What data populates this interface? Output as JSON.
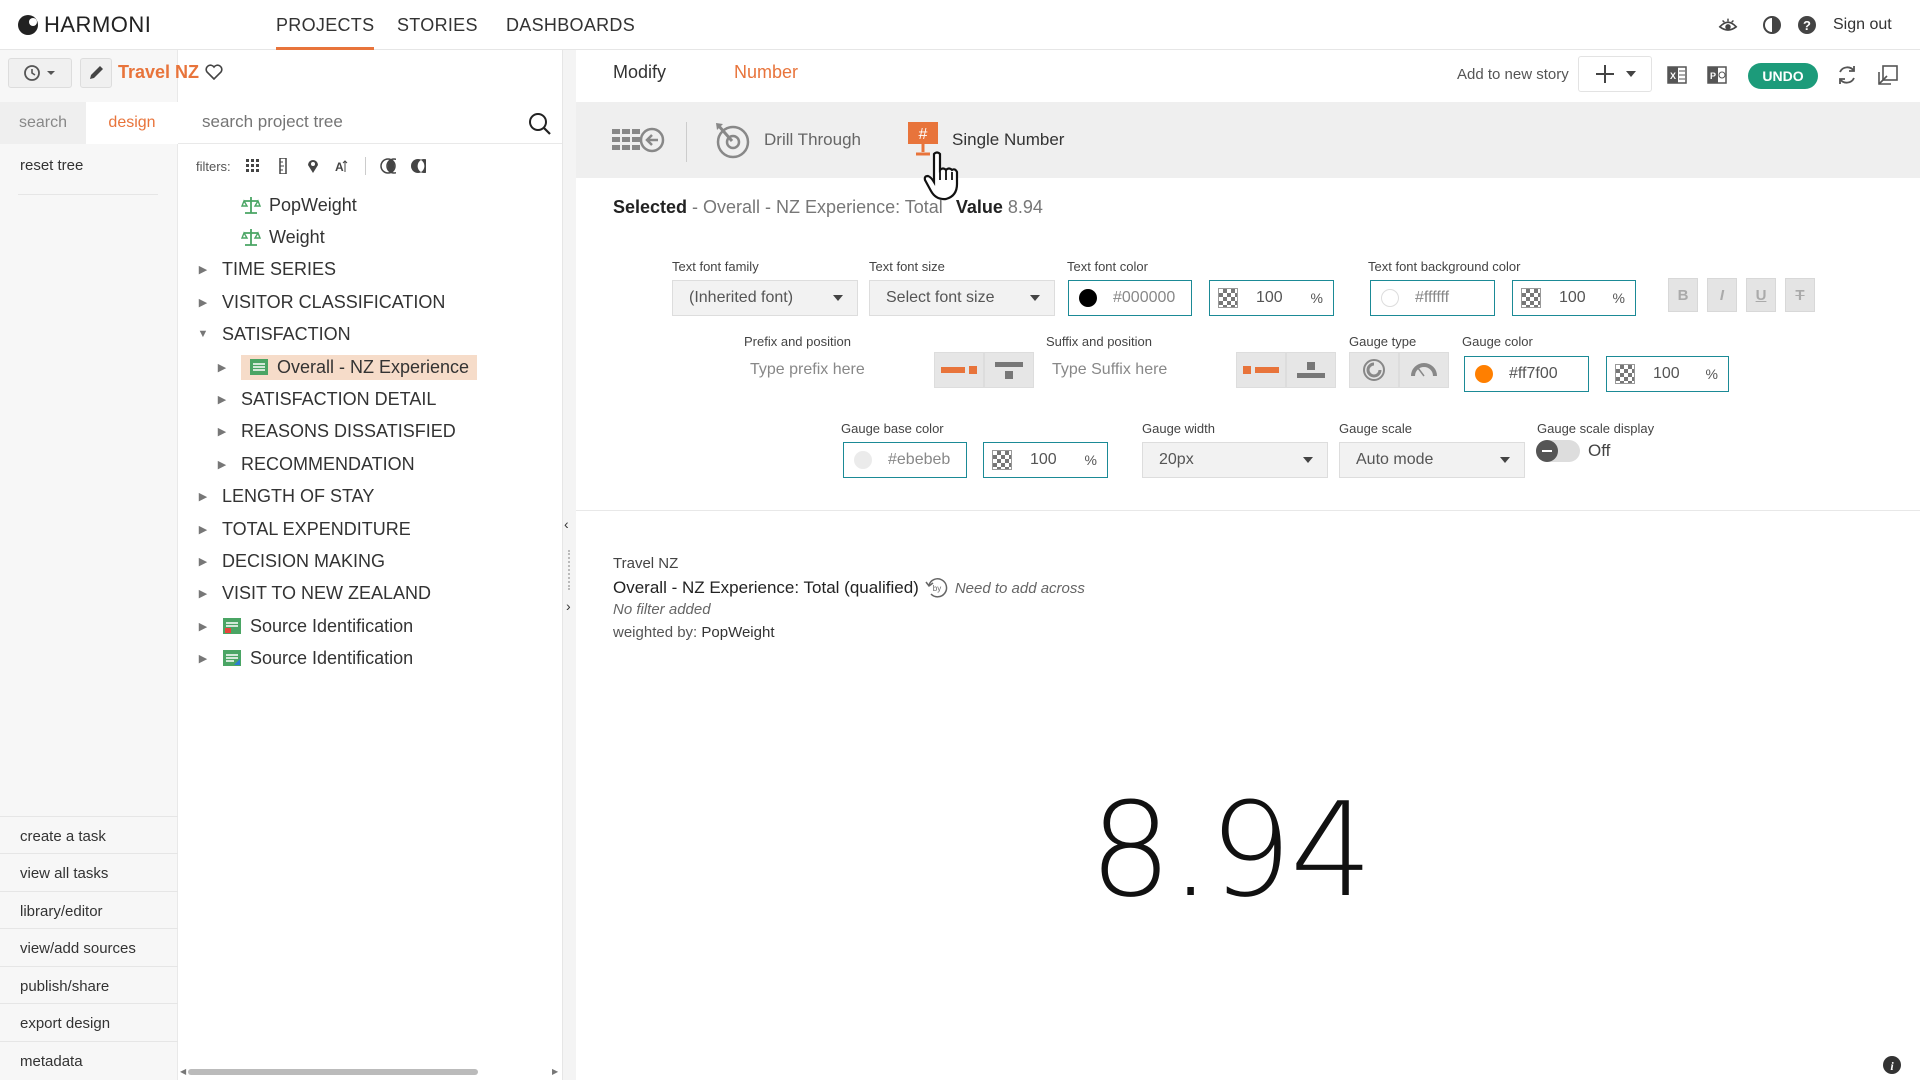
{
  "topnav": {
    "brand": "HARMONI",
    "items": [
      "PROJECTS",
      "STORIES",
      "DASHBOARDS"
    ],
    "sign_out": "Sign out"
  },
  "project": {
    "title": "Travel NZ"
  },
  "sidebar": {
    "tab_search": "search",
    "tab_design": "design",
    "reset_tree": "reset tree",
    "links": [
      "create a task",
      "view all tasks",
      "library/editor",
      "view/add sources",
      "publish/share",
      "export design",
      "metadata"
    ]
  },
  "tree": {
    "search_placeholder": "search project tree",
    "filters_label": "filters:",
    "items": [
      {
        "label": "PopWeight",
        "icon": "scale-icon",
        "indent": 1,
        "caret": ""
      },
      {
        "label": "Weight",
        "icon": "scale-icon",
        "indent": 1,
        "caret": ""
      },
      {
        "label": "TIME SERIES",
        "icon": "",
        "indent": 0,
        "caret": "right"
      },
      {
        "label": "VISITOR CLASSIFICATION",
        "icon": "",
        "indent": 0,
        "caret": "right"
      },
      {
        "label": "SATISFACTION",
        "icon": "",
        "indent": 0,
        "caret": "down"
      },
      {
        "label": "Overall - NZ Experience",
        "icon": "table-icon",
        "indent": 1,
        "caret": "right",
        "selected": true
      },
      {
        "label": "SATISFACTION DETAIL",
        "icon": "",
        "indent": 1,
        "caret": "right"
      },
      {
        "label": "REASONS DISSATISFIED",
        "icon": "",
        "indent": 1,
        "caret": "right"
      },
      {
        "label": "RECOMMENDATION",
        "icon": "",
        "indent": 1,
        "caret": "right"
      },
      {
        "label": "LENGTH OF STAY",
        "icon": "",
        "indent": 0,
        "caret": "right"
      },
      {
        "label": "TOTAL EXPENDITURE",
        "icon": "",
        "indent": 0,
        "caret": "right"
      },
      {
        "label": "DECISION MAKING",
        "icon": "",
        "indent": 0,
        "caret": "right"
      },
      {
        "label": "VISIT TO NEW ZEALAND",
        "icon": "",
        "indent": 0,
        "caret": "right"
      },
      {
        "label": "Source Identification",
        "icon": "source-red-icon",
        "indent": 0,
        "caret": "right"
      },
      {
        "label": "Source Identification",
        "icon": "source-green-icon",
        "indent": 0,
        "caret": "right"
      }
    ]
  },
  "right": {
    "tab_modify": "Modify",
    "tab_number": "Number",
    "add_to_story": "Add to new story",
    "undo": "UNDO",
    "toolbar": {
      "drill_through": "Drill Through",
      "single_number": "Single Number"
    },
    "selected": {
      "label": "Selected",
      "path": " - Overall - NZ Experience: Total",
      "value_label": "Value",
      "value": "8.94"
    },
    "form": {
      "text_font_family_label": "Text font family",
      "text_font_family_value": "(Inherited font)",
      "text_font_size_label": "Text font size",
      "text_font_size_value": "Select font size",
      "text_font_color_label": "Text font color",
      "text_font_color_value": "#000000",
      "text_font_color_opacity": "100",
      "text_bg_color_label": "Text font background color",
      "text_bg_color_value": "#ffffff",
      "text_bg_color_opacity": "100",
      "prefix_label": "Prefix and position",
      "prefix_placeholder": "Type prefix here",
      "suffix_label": "Suffix and position",
      "suffix_placeholder": "Type Suffix here",
      "gauge_type_label": "Gauge type",
      "gauge_color_label": "Gauge color",
      "gauge_color_value": "#ff7f00",
      "gauge_color_opacity": "100",
      "gauge_base_color_label": "Gauge base color",
      "gauge_base_color_value": "#ebebeb",
      "gauge_base_color_opacity": "100",
      "gauge_width_label": "Gauge width",
      "gauge_width_value": "20px",
      "gauge_scale_label": "Gauge scale",
      "gauge_scale_value": "Auto mode",
      "gauge_scale_display_label": "Gauge scale display",
      "gauge_scale_display_value": "Off",
      "pct": "%",
      "bold": "B",
      "italic": "I",
      "underline": "U",
      "strike": "T"
    },
    "report": {
      "project": "Travel NZ",
      "title": "Overall - NZ Experience: Total (qualified)",
      "need_across": "Need to add across",
      "no_filter": "No filter added",
      "weighted_by_label": "weighted by: ",
      "weighted_by_value": "PopWeight",
      "big_value": "8.94"
    }
  },
  "colors": {
    "accent": "#e8743b",
    "undo": "#1c9b7a",
    "teal_outline": "#1b8a96",
    "gauge": "#ff7f00"
  }
}
